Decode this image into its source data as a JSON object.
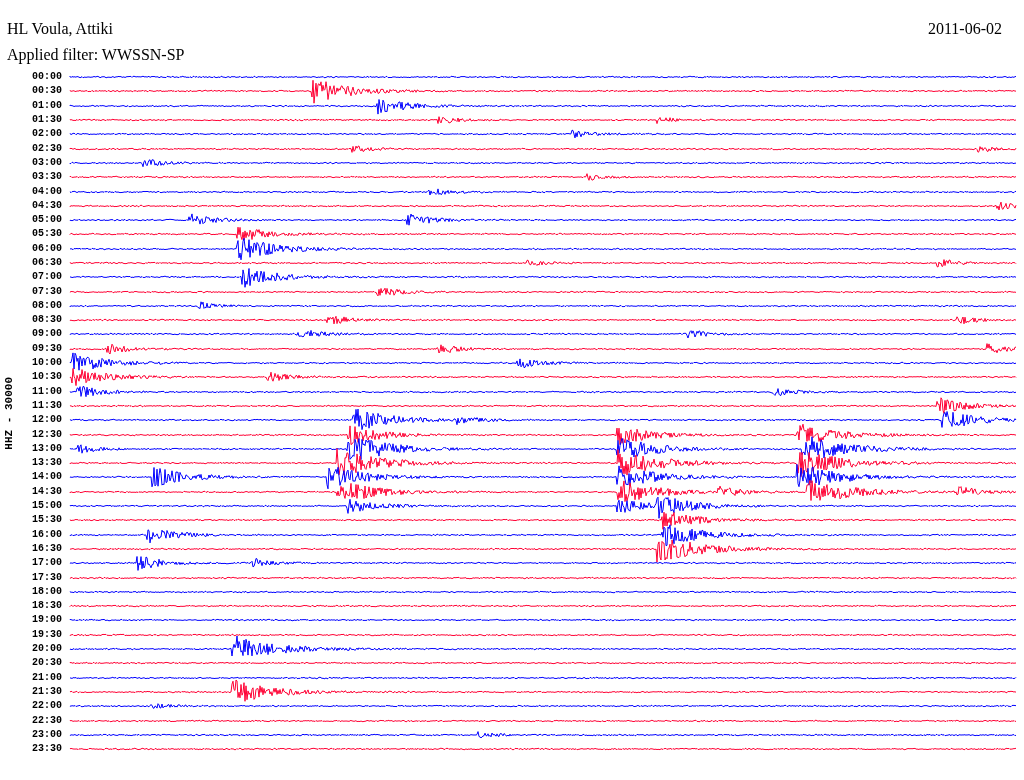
{
  "title": "HL Voula, Attiki",
  "date": "2011-06-02",
  "filter": "Applied filter: WWSSN-SP",
  "axis_label": "HHZ - 30000",
  "rows": [
    {
      "time": "00:00",
      "color": "#0000ff"
    },
    {
      "time": "00:30",
      "color": "#ff0033"
    },
    {
      "time": "01:00",
      "color": "#0000ff"
    },
    {
      "time": "01:30",
      "color": "#ff0033"
    },
    {
      "time": "02:00",
      "color": "#0000ff"
    },
    {
      "time": "02:30",
      "color": "#ff0033"
    },
    {
      "time": "03:00",
      "color": "#0000ff"
    },
    {
      "time": "03:30",
      "color": "#ff0033"
    },
    {
      "time": "04:00",
      "color": "#0000ff"
    },
    {
      "time": "04:30",
      "color": "#ff0033"
    },
    {
      "time": "05:00",
      "color": "#0000ff"
    },
    {
      "time": "05:30",
      "color": "#ff0033"
    },
    {
      "time": "06:00",
      "color": "#0000ff"
    },
    {
      "time": "06:30",
      "color": "#ff0033"
    },
    {
      "time": "07:00",
      "color": "#0000ff"
    },
    {
      "time": "07:30",
      "color": "#ff0033"
    },
    {
      "time": "08:00",
      "color": "#0000ff"
    },
    {
      "time": "08:30",
      "color": "#ff0033"
    },
    {
      "time": "09:00",
      "color": "#0000ff"
    },
    {
      "time": "09:30",
      "color": "#ff0033"
    },
    {
      "time": "10:00",
      "color": "#0000ff"
    },
    {
      "time": "10:30",
      "color": "#ff0033"
    },
    {
      "time": "11:00",
      "color": "#0000ff"
    },
    {
      "time": "11:30",
      "color": "#ff0033"
    },
    {
      "time": "12:00",
      "color": "#0000ff"
    },
    {
      "time": "12:30",
      "color": "#ff0033"
    },
    {
      "time": "13:00",
      "color": "#0000ff"
    },
    {
      "time": "13:30",
      "color": "#ff0033"
    },
    {
      "time": "14:00",
      "color": "#0000ff"
    },
    {
      "time": "14:30",
      "color": "#ff0033"
    },
    {
      "time": "15:00",
      "color": "#0000ff"
    },
    {
      "time": "15:30",
      "color": "#ff0033"
    },
    {
      "time": "16:00",
      "color": "#0000ff"
    },
    {
      "time": "16:30",
      "color": "#ff0033"
    },
    {
      "time": "17:00",
      "color": "#0000ff"
    },
    {
      "time": "17:30",
      "color": "#ff0033"
    },
    {
      "time": "18:00",
      "color": "#0000ff"
    },
    {
      "time": "18:30",
      "color": "#ff0033"
    },
    {
      "time": "19:00",
      "color": "#0000ff"
    },
    {
      "time": "19:30",
      "color": "#ff0033"
    },
    {
      "time": "20:00",
      "color": "#0000ff"
    },
    {
      "time": "20:30",
      "color": "#ff0033"
    },
    {
      "time": "21:00",
      "color": "#0000ff"
    },
    {
      "time": "21:30",
      "color": "#ff0033"
    },
    {
      "time": "22:00",
      "color": "#0000ff"
    },
    {
      "time": "22:30",
      "color": "#ff0033"
    },
    {
      "time": "23:00",
      "color": "#0000ff"
    },
    {
      "time": "23:30",
      "color": "#ff0033"
    }
  ]
}
